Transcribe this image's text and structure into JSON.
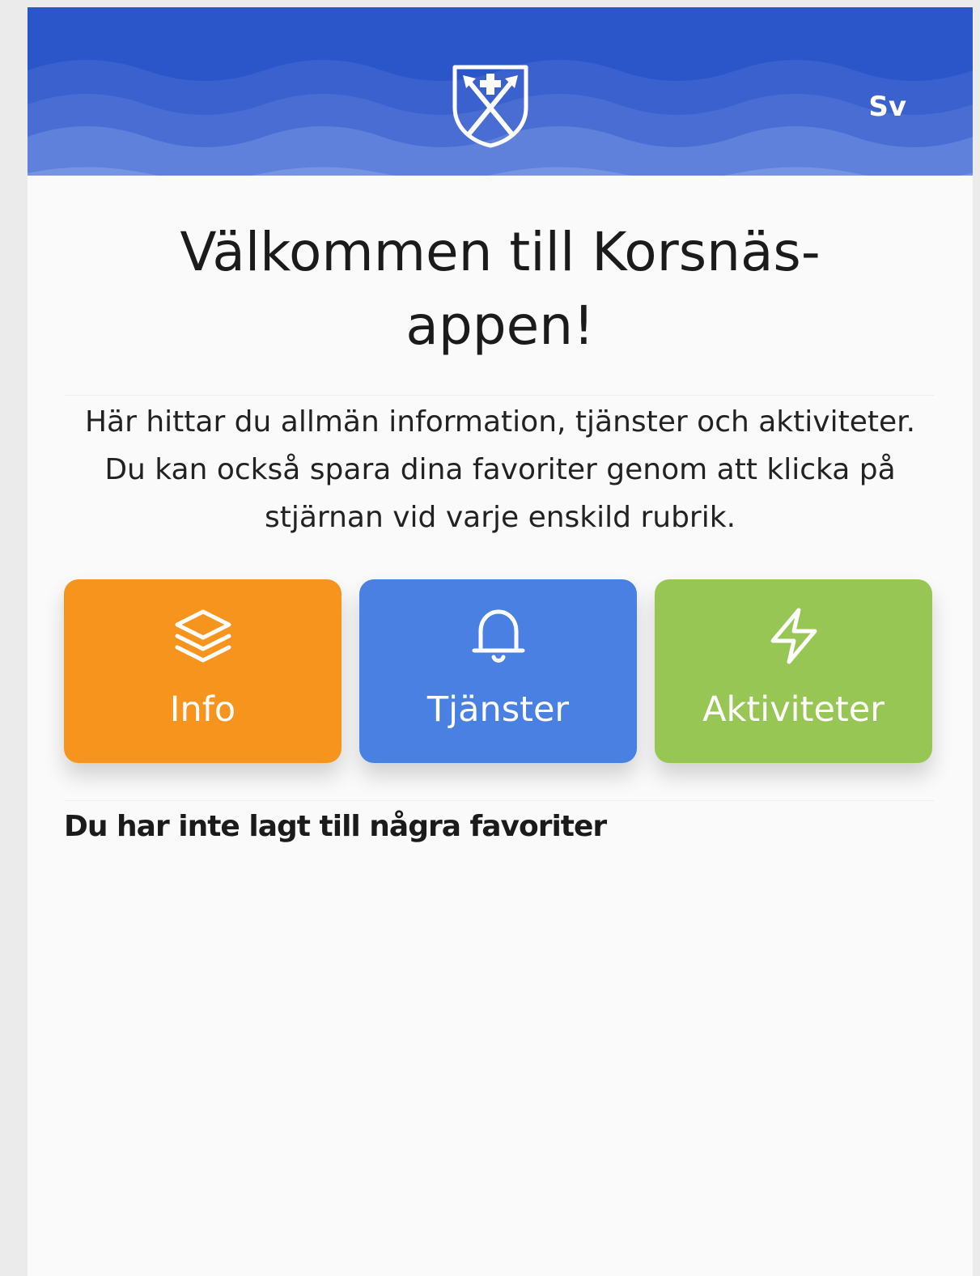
{
  "header": {
    "colors": {
      "background": "#2b56c9",
      "wave": "#6f8fe0"
    },
    "crest_icon": "municipal-coat-of-arms",
    "language_label": "Sv"
  },
  "welcome": {
    "title": "Välkommen till Korsnäs-appen!",
    "description": "Här hittar du allmän information, tjänster och aktiviteter. Du kan också spara dina favoriter genom att klicka på stjärnan vid varje enskild rubrik."
  },
  "tiles": [
    {
      "label": "Info",
      "icon": "layers-icon",
      "color": "#f7941d"
    },
    {
      "label": "Tjänster",
      "icon": "bell-icon",
      "color": "#4a80e2"
    },
    {
      "label": "Aktiviteter",
      "icon": "lightning-icon",
      "color": "#98c655"
    }
  ],
  "favorites": {
    "empty_text": "Du har inte lagt till några favoriter"
  }
}
